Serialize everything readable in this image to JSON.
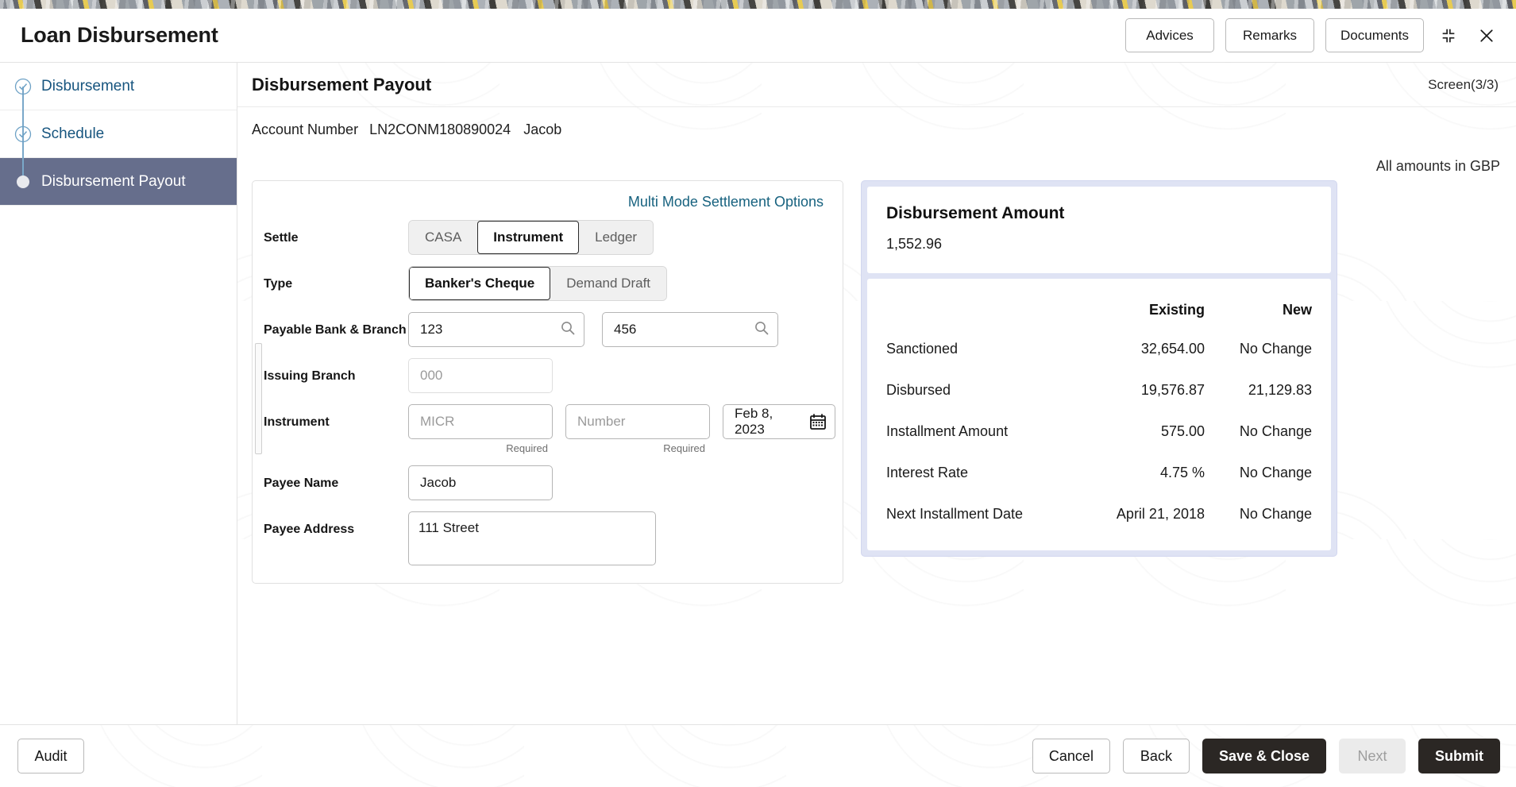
{
  "window": {
    "title": "Loan Disbursement",
    "actions": [
      {
        "label": "Advices",
        "name": "advices-button"
      },
      {
        "label": "Remarks",
        "name": "remarks-button"
      },
      {
        "label": "Documents",
        "name": "documents-button"
      }
    ],
    "minimize_icon": "collapse-icon",
    "close_icon": "close-icon"
  },
  "sidebar": {
    "steps": [
      {
        "label": "Disbursement",
        "state": "done"
      },
      {
        "label": "Schedule",
        "state": "done"
      },
      {
        "label": "Disbursement Payout",
        "state": "active"
      }
    ]
  },
  "main": {
    "title": "Disbursement Payout",
    "screen_counter": "Screen(3/3)",
    "account_label": "Account Number",
    "account_number": "LN2CONM180890024",
    "account_name": "Jacob",
    "currency_note": "All amounts in GBP"
  },
  "form": {
    "multi_mode_link": "Multi Mode Settlement Options",
    "settle": {
      "label": "Settle",
      "options": [
        "CASA",
        "Instrument",
        "Ledger"
      ],
      "selected": "Instrument"
    },
    "type": {
      "label": "Type",
      "options": [
        "Banker's Cheque",
        "Demand Draft"
      ],
      "selected": "Banker's Cheque"
    },
    "payable_bank_branch": {
      "label": "Payable Bank & Branch",
      "bank_value": "123",
      "branch_value": "456",
      "search_icon": "search-icon"
    },
    "issuing_branch": {
      "label": "Issuing Branch",
      "placeholder": "000",
      "value": ""
    },
    "instrument": {
      "label": "Instrument",
      "micr_placeholder": "MICR",
      "micr_value": "",
      "micr_helper": "Required",
      "number_placeholder": "Number",
      "number_value": "",
      "number_helper": "Required",
      "date_value": "Feb 8, 2023",
      "calendar_icon": "calendar-icon"
    },
    "payee_name": {
      "label": "Payee Name",
      "value": "Jacob"
    },
    "payee_address": {
      "label": "Payee Address",
      "value": "111 Street"
    }
  },
  "summary": {
    "amount_title": "Disbursement Amount",
    "amount_value": "1,552.96",
    "columns": [
      "",
      "Existing",
      "New"
    ],
    "rows": [
      {
        "label": "Sanctioned",
        "existing": "32,654.00",
        "new": "No Change"
      },
      {
        "label": "Disbursed",
        "existing": "19,576.87",
        "new": "21,129.83"
      },
      {
        "label": "Installment Amount",
        "existing": "575.00",
        "new": "No Change"
      },
      {
        "label": "Interest Rate",
        "existing": "4.75 %",
        "new": "No Change"
      },
      {
        "label": "Next Installment Date",
        "existing": "April 21, 2018",
        "new": "No Change"
      }
    ]
  },
  "footer": {
    "audit": "Audit",
    "cancel": "Cancel",
    "back": "Back",
    "save_close": "Save & Close",
    "next": "Next",
    "submit": "Submit"
  },
  "colors": {
    "accent_link": "#17627f",
    "step_text": "#17557f",
    "active_step_bg": "#666e8c",
    "panel_bg": "#dfe3f4",
    "dark_button": "#2b2724"
  }
}
